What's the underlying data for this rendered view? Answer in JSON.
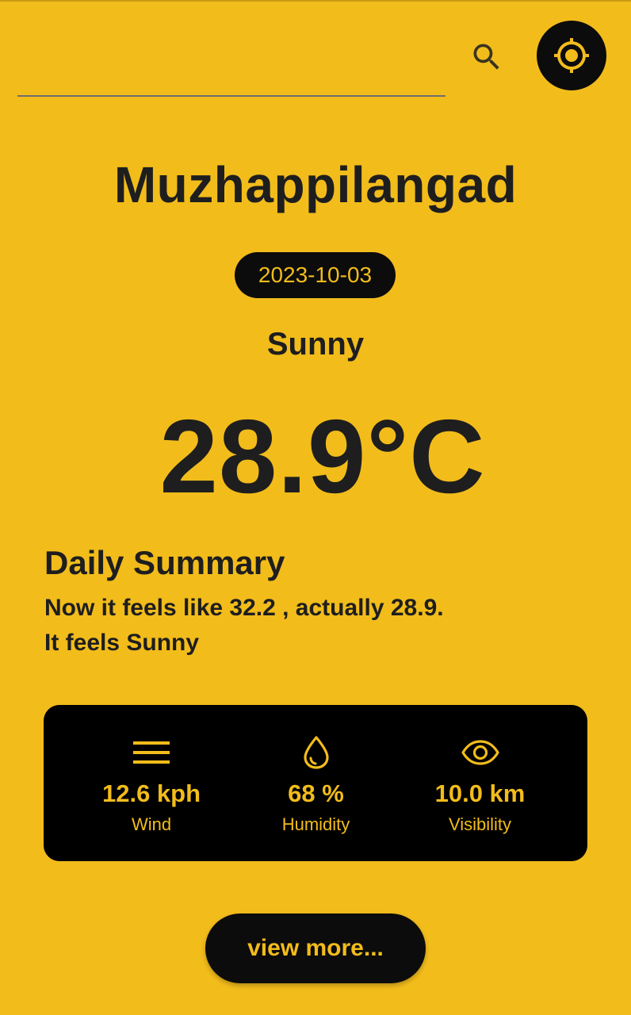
{
  "search": {
    "value": "",
    "placeholder": ""
  },
  "icons": {
    "search": "search-icon",
    "locate": "my-location-icon",
    "wind": "wind-lines-icon",
    "humidity": "water-drop-icon",
    "visibility": "eye-icon"
  },
  "location": {
    "city": "Muzhappilangad",
    "date": "2023-10-03"
  },
  "current": {
    "condition": "Sunny",
    "temperature": "28.9°C"
  },
  "summary": {
    "title": "Daily Summary",
    "line1": "Now it feels like 32.2 , actually 28.9.",
    "line2": "It feels Sunny"
  },
  "stats": {
    "wind": {
      "value": "12.6 kph",
      "label": "Wind"
    },
    "humidity": {
      "value": "68 %",
      "label": "Humidity"
    },
    "visibility": {
      "value": "10.0 km",
      "label": "Visibility"
    }
  },
  "actions": {
    "view_more": "view more..."
  },
  "colors": {
    "background": "#F2BC1B",
    "dark": "#0C0C0C",
    "text": "#1E1E1E",
    "accent": "#F2BC1B"
  }
}
